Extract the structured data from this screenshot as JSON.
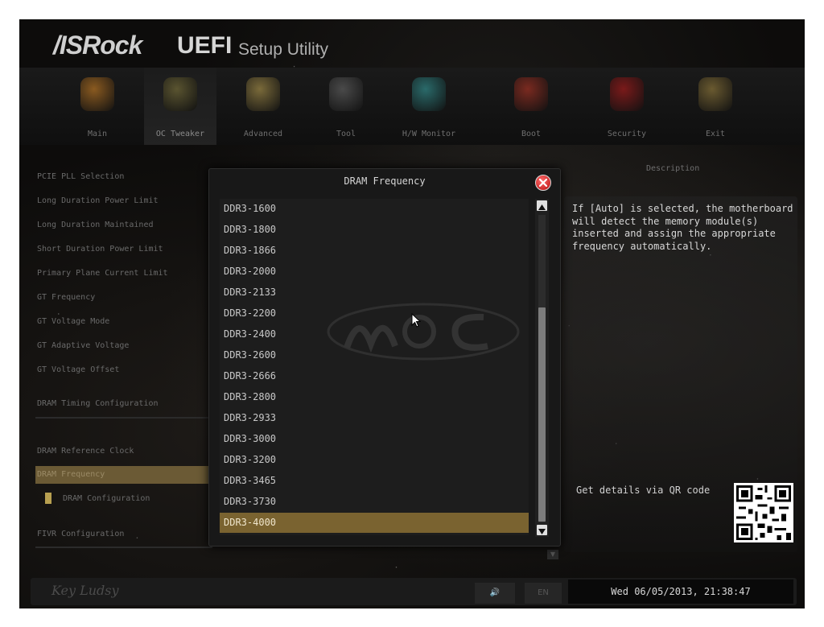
{
  "header": {
    "brand": "/ISRock",
    "uefi": "UEFI",
    "utility": "Setup Utility"
  },
  "tabs": [
    {
      "label": "Main",
      "active": false,
      "color": "#8a5a20"
    },
    {
      "label": "OC Tweaker",
      "active": true,
      "color": "#5a5430"
    },
    {
      "label": "Advanced",
      "active": false,
      "color": "#7a6a3a"
    },
    {
      "label": "Tool",
      "active": false,
      "color": "#4a4a4a"
    },
    {
      "label": "H/W Monitor",
      "active": false,
      "color": "#2a6a6a"
    },
    {
      "label": "Boot",
      "active": false,
      "color": "#7a2a20"
    },
    {
      "label": "Security",
      "active": false,
      "color": "#7a1a1a"
    },
    {
      "label": "Exit",
      "active": false,
      "color": "#6a5a30"
    }
  ],
  "settings": [
    "PCIE PLL Selection",
    "Long Duration Power Limit",
    "Long Duration Maintained",
    "Short Duration Power Limit",
    "Primary Plane Current Limit",
    "GT Frequency",
    "GT Voltage Mode",
    "GT Adaptive Voltage",
    "GT Voltage Offset",
    "DRAM Timing Configuration",
    "DRAM Reference Clock",
    "DRAM Frequency",
    "DRAM Configuration",
    "FIVR Configuration"
  ],
  "description": {
    "title": "Description",
    "text": "If [Auto] is selected, the motherboard will detect the memory module(s) inserted and assign the appropriate frequency automatically.",
    "qr_label": "Get details via QR code"
  },
  "dialog": {
    "title": "DRAM Frequency",
    "selected": "DDR3-4000",
    "options": [
      "DDR3-1600",
      "DDR3-1800",
      "DDR3-1866",
      "DDR3-2000",
      "DDR3-2133",
      "DDR3-2200",
      "DDR3-2400",
      "DDR3-2600",
      "DDR3-2666",
      "DDR3-2800",
      "DDR3-2933",
      "DDR3-3000",
      "DDR3-3200",
      "DDR3-3465",
      "DDR3-3730",
      "DDR3-4000"
    ]
  },
  "status": {
    "signature": "Key Ludsy",
    "lang": "EN",
    "datetime": "Wed 06/05/2013, 21:38:47"
  },
  "colors": {
    "accent": "#7a6330",
    "close": "#c81414"
  }
}
